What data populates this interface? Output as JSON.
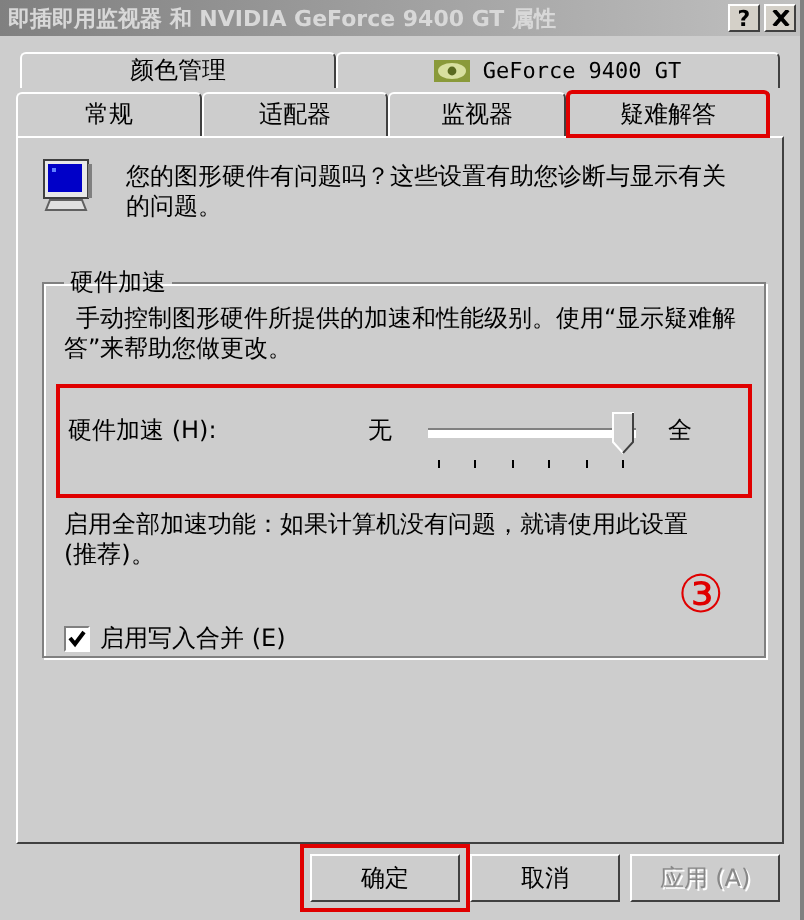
{
  "window": {
    "title": "即插即用监视器 和 NVIDIA GeForce 9400 GT 属性",
    "help_button": "?"
  },
  "tab_rows": [
    {
      "tabs": [
        {
          "label": "颜色管理",
          "selected": false,
          "kind": "text",
          "highlighted": false
        },
        {
          "label": "GeForce 9400 GT",
          "selected": false,
          "kind": "logo",
          "highlighted": false
        }
      ]
    },
    {
      "tabs": [
        {
          "label": "常规",
          "selected": false,
          "kind": "text",
          "highlighted": false
        },
        {
          "label": "适配器",
          "selected": false,
          "kind": "text",
          "highlighted": false
        },
        {
          "label": "监视器",
          "selected": false,
          "kind": "text",
          "highlighted": false
        },
        {
          "label": "疑难解答",
          "selected": true,
          "kind": "text",
          "highlighted": true
        }
      ]
    }
  ],
  "intro": "您的图形硬件有问题吗？这些设置有助您诊断与显示有关的问题。",
  "group": {
    "legend": "硬件加速",
    "description": "手动控制图形硬件所提供的加速和性能级别。使用“显示疑难解答”来帮助您做更改。",
    "slider": {
      "label": "硬件加速 (H):",
      "min_label": "无",
      "max_label": "全",
      "level": 1,
      "highlighted": true
    },
    "note": "启用全部加速功能：如果计算机没有问题，就请使用此设置(推荐)。",
    "marker": "③",
    "checkbox": {
      "label": "启用写入合并 (E)",
      "checked": true
    }
  },
  "buttons": [
    {
      "label": "确定",
      "disabled": false,
      "highlighted": true
    },
    {
      "label": "取消",
      "disabled": false,
      "highlighted": false
    },
    {
      "label": "应用 (A)",
      "disabled": true,
      "highlighted": false
    }
  ]
}
